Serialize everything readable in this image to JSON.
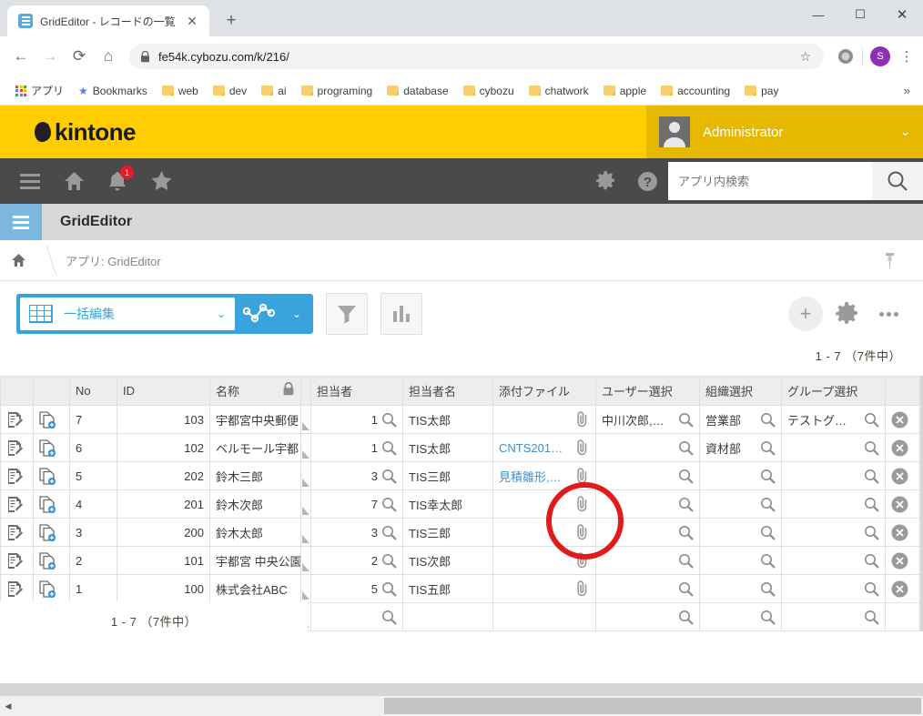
{
  "browser": {
    "tab": {
      "title": "GridEditor - レコードの一覧",
      "favicon": "grid-favicon",
      "close": "✕"
    },
    "newtab_label": "+",
    "window_controls": {
      "minimize": "—",
      "maximize": "☐",
      "close": "✕"
    },
    "nav": {
      "back": "←",
      "forward": "→",
      "reload": "⟳",
      "home": "⌂"
    },
    "omnibox": {
      "url": "fe54k.cybozu.com/k/216/",
      "lock_icon": "lock-icon",
      "star_icon": "star-icon"
    },
    "profile_initial": "S",
    "bookmarks": [
      {
        "label": "アプリ",
        "icon": "apps-grid-icon"
      },
      {
        "label": "Bookmarks",
        "icon": "star-icon"
      },
      {
        "label": "web",
        "icon": "folder-icon"
      },
      {
        "label": "dev",
        "icon": "folder-icon"
      },
      {
        "label": "ai",
        "icon": "folder-icon"
      },
      {
        "label": "programing",
        "icon": "folder-icon"
      },
      {
        "label": "database",
        "icon": "folder-icon"
      },
      {
        "label": "cybozu",
        "icon": "folder-icon"
      },
      {
        "label": "chatwork",
        "icon": "folder-icon"
      },
      {
        "label": "apple",
        "icon": "folder-icon"
      },
      {
        "label": "accounting",
        "icon": "folder-icon"
      },
      {
        "label": "pay",
        "icon": "folder-icon"
      }
    ],
    "bookmarks_overflow": "»"
  },
  "kintone": {
    "logo_text": "kintone",
    "user_name": "Administrator",
    "user_caret": "⌄",
    "notification_count": "1",
    "navbar_icons": [
      "hamburger-icon",
      "home-icon",
      "bell-icon",
      "star-icon",
      "gear-icon",
      "help-icon"
    ],
    "search": {
      "placeholder": "アプリ内検索",
      "value": ""
    }
  },
  "app": {
    "title": "GridEditor",
    "breadcrumb_home": "home-icon",
    "breadcrumb_text": "アプリ: GridEditor",
    "pin_icon": "pin-icon"
  },
  "toolbar": {
    "bulk_edit_label": "一括編集",
    "bulk_edit_caret": "⌄",
    "graph_caret": "⌄",
    "filter_icon": "funnel-icon",
    "chart_icon": "bar-chart-icon",
    "add_label": "+",
    "gear_icon": "gear-icon",
    "more_icon": "more-dots-icon",
    "accent_color": "#39a3dd"
  },
  "pagination": {
    "top": "1 - 7 （7件中）",
    "bottom": "1 - 7 （7件中）"
  },
  "grid": {
    "columns": [
      {
        "key": "edit",
        "label": ""
      },
      {
        "key": "copy",
        "label": ""
      },
      {
        "key": "no",
        "label": "No"
      },
      {
        "key": "id",
        "label": "ID"
      },
      {
        "key": "name",
        "label": "名称",
        "lock": true
      },
      {
        "key": "resize1",
        "label": ""
      },
      {
        "key": "tanto",
        "label": "担当者"
      },
      {
        "key": "tantomei",
        "label": "担当者名"
      },
      {
        "key": "file",
        "label": "添付ファイル"
      },
      {
        "key": "user",
        "label": "ユーザー選択"
      },
      {
        "key": "org",
        "label": "組織選択"
      },
      {
        "key": "group",
        "label": "グループ選択"
      },
      {
        "key": "del",
        "label": ""
      }
    ],
    "rows": [
      {
        "no": "7",
        "id": "103",
        "name": "宇都宮中央郵便",
        "tanto": "1",
        "tantomei": "TIS太郎",
        "file": "",
        "user": "中川次郎,…",
        "org": "営業部",
        "group": "テストグ…"
      },
      {
        "no": "6",
        "id": "102",
        "name": "ベルモール宇都",
        "tanto": "1",
        "tantomei": "TIS太郎",
        "file": "CNTS201…",
        "user": "",
        "org": "資材部",
        "group": ""
      },
      {
        "no": "5",
        "id": "202",
        "name": "鈴木三郎",
        "tanto": "3",
        "tantomei": "TIS三郎",
        "file": "見積雛形,…",
        "user": "",
        "org": "",
        "group": ""
      },
      {
        "no": "4",
        "id": "201",
        "name": "鈴木次郎",
        "tanto": "7",
        "tantomei": "TIS幸太郎",
        "file": "",
        "user": "",
        "org": "",
        "group": ""
      },
      {
        "no": "3",
        "id": "200",
        "name": "鈴木太郎",
        "tanto": "3",
        "tantomei": "TIS三郎",
        "file": "",
        "user": "",
        "org": "",
        "group": ""
      },
      {
        "no": "2",
        "id": "101",
        "name": "宇都宮 中央公園",
        "tanto": "2",
        "tantomei": "TIS次郎",
        "file": "",
        "user": "",
        "org": "",
        "group": ""
      },
      {
        "no": "1",
        "id": "100",
        "name": "株式会社ABC",
        "tanto": "5",
        "tantomei": "TIS五郎",
        "file": "",
        "user": "",
        "org": "",
        "group": ""
      },
      {
        "no": "",
        "id": "",
        "name": "",
        "tanto": "",
        "tantomei": "",
        "file": "",
        "user": "",
        "org": "",
        "group": "",
        "blank": true
      }
    ]
  },
  "annotation": {
    "shape": "red-circle",
    "color": "#e01b1b"
  },
  "scrollbar": {
    "left_arrow": "◀"
  }
}
